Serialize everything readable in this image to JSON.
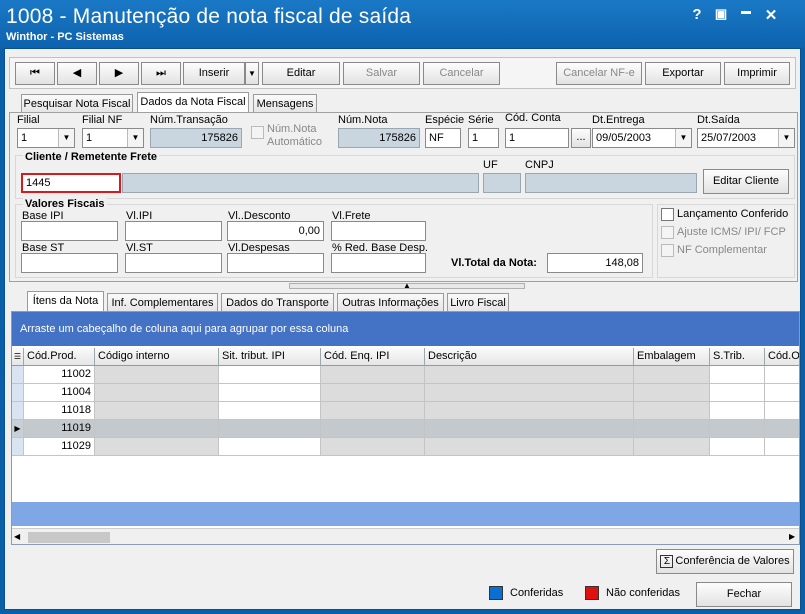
{
  "window": {
    "title": "1008 - Manutenção de nota fiscal de saída",
    "subtitle": "Winthor - PC Sistemas",
    "help": "?",
    "restore": "▣",
    "minimize": "▬",
    "close": "✕"
  },
  "toolbar": {
    "first": "⏮",
    "prev": "◀",
    "next": "▶",
    "last": "⏭",
    "inserir": "Inserir",
    "inserir_arrow": "▼",
    "editar": "Editar",
    "salvar": "Salvar",
    "cancelar": "Cancelar",
    "cancelar_nfe": "Cancelar NF-e",
    "exportar": "Exportar",
    "imprimir": "Imprimir"
  },
  "main_tabs": [
    "Pesquisar Nota Fiscal",
    "Dados da Nota Fiscal",
    "Mensagens"
  ],
  "fields": {
    "filial_label": "Filial",
    "filial_value": "1",
    "filial_nf_label": "Filial NF",
    "filial_nf_value": "1",
    "num_transacao_label": "Núm.Transação",
    "num_transacao_value": "175826",
    "num_nota_auto_label_1": "Núm.Nota",
    "num_nota_auto_label_2": "Automático",
    "num_nota_label": "Núm.Nota",
    "num_nota_value": "175826",
    "especie_label": "Espécie",
    "especie_value": "NF",
    "serie_label": "Série",
    "serie_value": "1",
    "cod_conta_label": "Cód. Conta",
    "cod_conta_value": "1",
    "cod_conta_btn": "...",
    "dt_entrega_label": "Dt.Entrega",
    "dt_entrega_value": "09/05/2003",
    "dt_saida_label": "Dt.Saída",
    "dt_saida_value": "25/07/2003"
  },
  "cliente": {
    "section_label": "Cliente / Remetente Frete",
    "code_value": "1445",
    "uf_label": "UF",
    "cnpj_label": "CNPJ",
    "editar_btn": "Editar Cliente"
  },
  "valores": {
    "section_label": "Valores Fiscais",
    "base_ipi_label": "Base IPI",
    "vl_ipi_label": "Vl.IPI",
    "vl_desconto_label": "Vl..Desconto",
    "vl_desconto_value": "0,00",
    "vl_frete_label": "Vl.Frete",
    "base_st_label": "Base ST",
    "vl_st_label": "Vl.ST",
    "vl_despesas_label": "Vl.Despesas",
    "red_base_label": "% Red. Base Desp.",
    "total_label": "Vl.Total da Nota:",
    "total_value": "148,08"
  },
  "checks": {
    "lancamento": "Lançamento Conferido",
    "ajuste": "Ajuste ICMS/ IPI/ FCP",
    "nf_complementar": "NF Complementar"
  },
  "sub_tabs": [
    "Ítens da Nota",
    "Inf. Complementares",
    "Dados do Transporte",
    "Outras Informações",
    "Livro Fiscal"
  ],
  "grid": {
    "group_hint": "Arraste um cabeçalho de coluna aqui para agrupar por essa coluna",
    "columns": [
      "Cód.Prod.",
      "Código interno",
      "Sit. tribut. IPI",
      "Cód. Enq. IPI",
      "Descrição",
      "Embalagem",
      "S.Trib.",
      "Cód.O"
    ],
    "rows": [
      {
        "cod": "11002"
      },
      {
        "cod": "11004"
      },
      {
        "cod": "11018"
      },
      {
        "cod": "11019"
      },
      {
        "cod": "11029"
      }
    ]
  },
  "footer": {
    "conferencia_btn": "Conferência de Valores",
    "legend_conferidas": "Conferidas",
    "legend_nao_conferidas": "Não conferidas",
    "fechar_btn": "Fechar",
    "color_conferidas": "#0a6fd1",
    "color_nao_conferidas": "#e01010"
  }
}
